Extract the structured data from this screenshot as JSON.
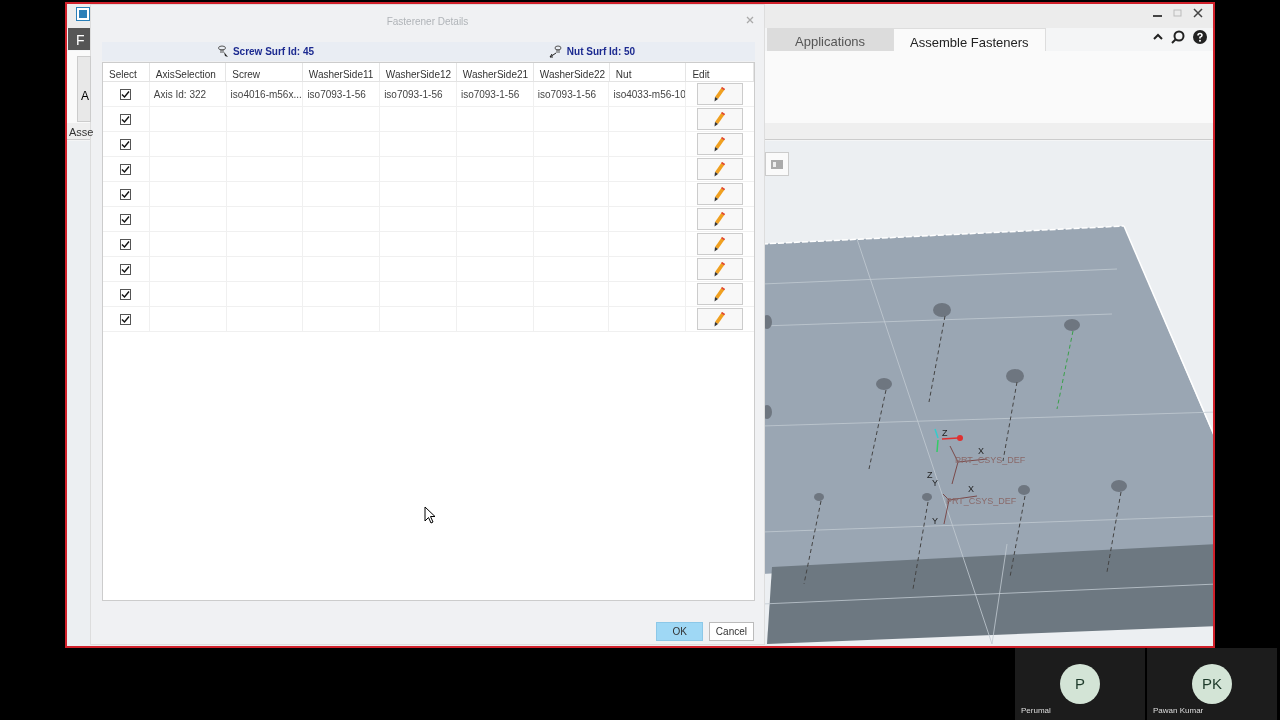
{
  "app_window": {
    "left_strip": {
      "tab_letter": "F",
      "button_letter": "A",
      "group_label": "Asse"
    },
    "ribbon_tabs": [
      {
        "label": "Applications",
        "selected": false
      },
      {
        "label": "Assemble Fasteners",
        "selected": true
      }
    ],
    "viewport_labels": [
      {
        "kind": "axis",
        "text": "Z"
      },
      {
        "kind": "axis",
        "text": "X"
      },
      {
        "kind": "csys",
        "text": "PRT_CSYS_DEF"
      },
      {
        "kind": "axis",
        "text": "Z"
      },
      {
        "kind": "axis",
        "text": "Y"
      },
      {
        "kind": "axis",
        "text": "X"
      },
      {
        "kind": "csys",
        "text": "PRT_CSYS_DEF"
      },
      {
        "kind": "axis",
        "text": "Y"
      }
    ]
  },
  "dialog": {
    "title": "Fasterener Details",
    "screw_surf": "Screw Surf Id: 45",
    "nut_surf": "Nut Surf Id: 50",
    "columns": [
      "Select",
      "AxisSelection",
      "Screw",
      "WasherSide11",
      "WasherSide12",
      "WasherSide21",
      "WasherSide22",
      "Nut",
      "Edit"
    ],
    "rows": [
      {
        "checked": true,
        "cells": [
          "Axis Id: 322",
          "iso4016-m56x...",
          "iso7093-1-56",
          "iso7093-1-56",
          "iso7093-1-56",
          "iso7093-1-56",
          "iso4033-m56-10"
        ]
      },
      {
        "checked": true
      },
      {
        "checked": true
      },
      {
        "checked": true
      },
      {
        "checked": true
      },
      {
        "checked": true
      },
      {
        "checked": true
      },
      {
        "checked": true
      },
      {
        "checked": true
      },
      {
        "checked": true
      }
    ],
    "buttons": [
      {
        "label": "OK",
        "selected": true
      },
      {
        "label": "Cancel",
        "selected": false
      }
    ]
  },
  "participants": [
    {
      "initials": "P",
      "name": "Perumal"
    },
    {
      "initials": "PK",
      "name": "Pawan Kumar"
    }
  ]
}
